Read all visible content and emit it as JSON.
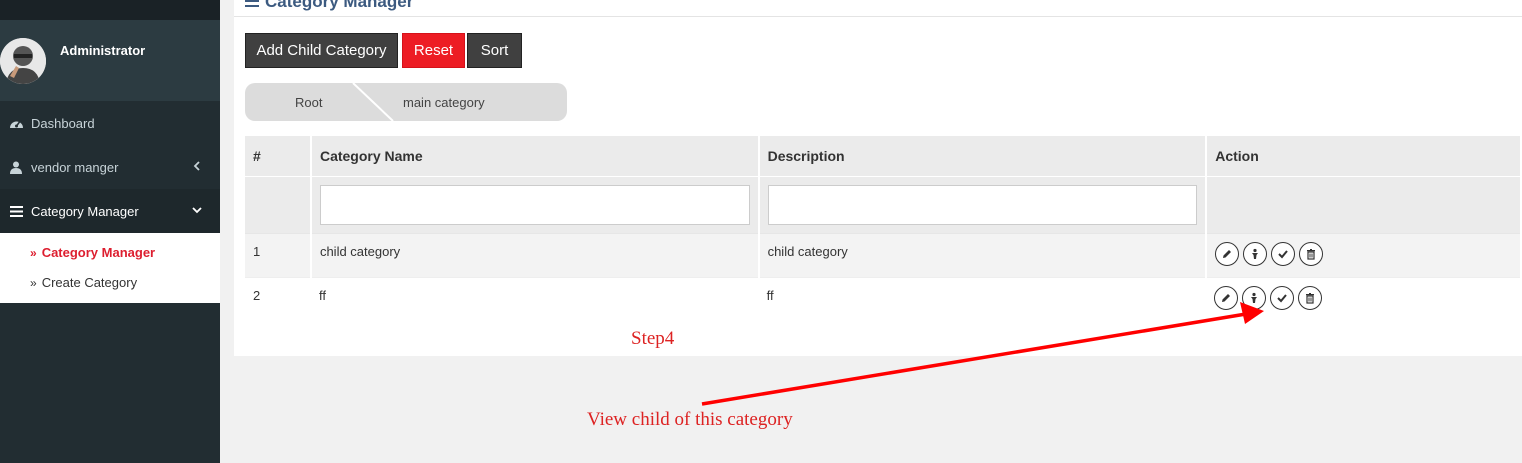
{
  "page": {
    "title": "Category Manager"
  },
  "user": {
    "name": "Administrator"
  },
  "sidebar": {
    "items": [
      {
        "label": "Dashboard",
        "icon": "dashboard-icon"
      },
      {
        "label": "vendor manger",
        "icon": "user-icon"
      },
      {
        "label": "Category Manager",
        "icon": "bars-icon"
      }
    ],
    "submenu": [
      {
        "label": "Category Manager",
        "active": true
      },
      {
        "label": "Create Category",
        "active": false
      }
    ]
  },
  "toolbar": {
    "add_child": "Add Child Category",
    "reset": "Reset",
    "sort": "Sort"
  },
  "breadcrumb": [
    "Root",
    "main category"
  ],
  "table": {
    "headers": [
      "#",
      "Category Name",
      "Description",
      "Action"
    ],
    "rows": [
      {
        "num": "1",
        "name": "child category",
        "description": "child category"
      },
      {
        "num": "2",
        "name": "ff",
        "description": "ff"
      }
    ],
    "action_icons": [
      "edit-icon",
      "view-children-icon",
      "approve-icon",
      "delete-icon"
    ]
  },
  "annotations": {
    "step": "Step4",
    "note": "View child  of this category"
  },
  "colors": {
    "sidebar_bg": "#222d32",
    "accent_red": "#ed1c24",
    "button_dark": "#404040",
    "annotation_red": "#dd2222"
  }
}
